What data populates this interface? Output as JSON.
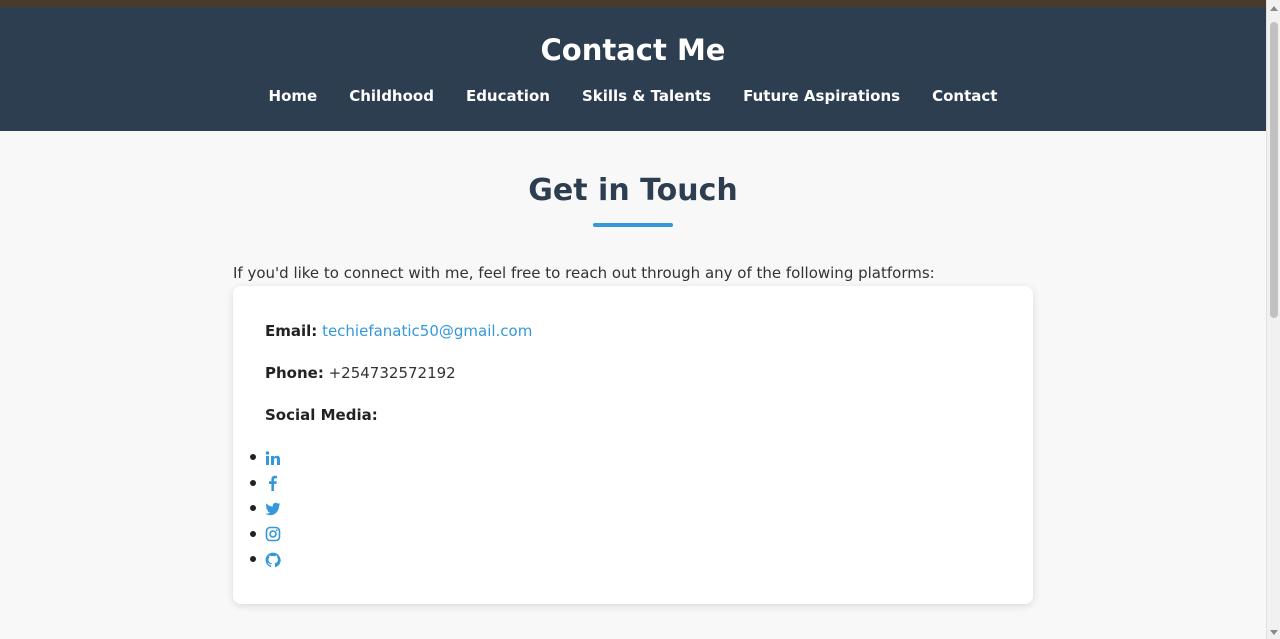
{
  "header": {
    "title": "Contact Me",
    "nav": [
      {
        "label": "Home"
      },
      {
        "label": "Childhood"
      },
      {
        "label": "Education"
      },
      {
        "label": "Skills & Talents"
      },
      {
        "label": "Future Aspirations"
      },
      {
        "label": "Contact"
      }
    ]
  },
  "main": {
    "section_title": "Get in Touch",
    "intro": "If you'd like to connect with me, feel free to reach out through any of the following platforms:",
    "email_label": "Email:",
    "email_value": "techiefanatic50@gmail.com",
    "phone_label": "Phone:",
    "phone_value": "+254732572192",
    "social_label": "Social Media:",
    "social_icons": [
      "linkedin-icon",
      "facebook-icon",
      "twitter-icon",
      "instagram-icon",
      "github-icon"
    ]
  },
  "colors": {
    "header_bg": "#2c3e50",
    "accent": "#3498db",
    "page_bg": "#f8f8f8",
    "top_strip": "#4a3a2a"
  }
}
